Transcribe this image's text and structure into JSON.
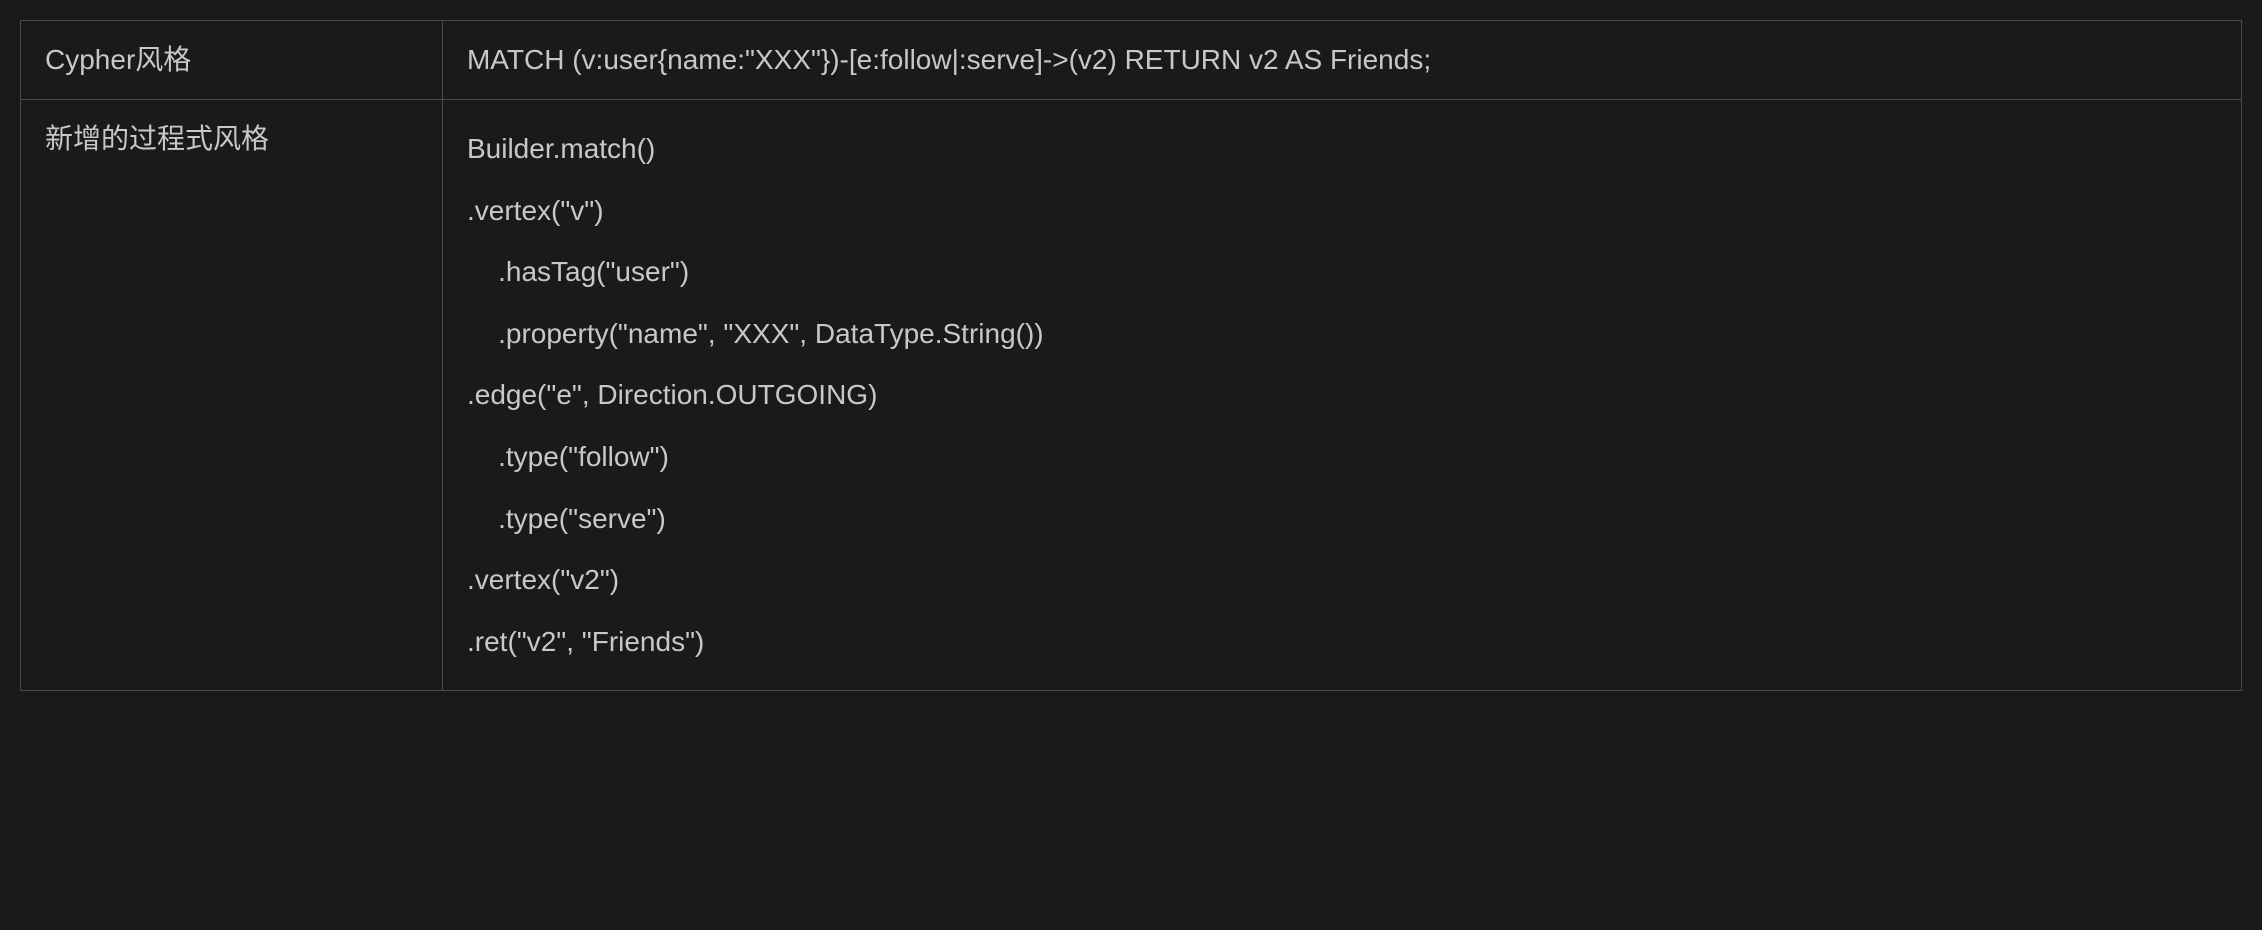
{
  "table": {
    "row1": {
      "label": "Cypher风格",
      "content": "MATCH (v:user{name:\"XXX\"})-[e:follow|:serve]->(v2)  RETURN v2 AS Friends;"
    },
    "row2": {
      "label": "新增的过程式风格",
      "content": "Builder.match()\n.vertex(\"v\")\n    .hasTag(\"user\")\n    .property(\"name\", \"XXX\", DataType.String())\n.edge(\"e\", Direction.OUTGOING)\n    .type(\"follow\")\n    .type(\"serve\")\n.vertex(\"v2\")\n.ret(\"v2\", \"Friends\")"
    }
  }
}
